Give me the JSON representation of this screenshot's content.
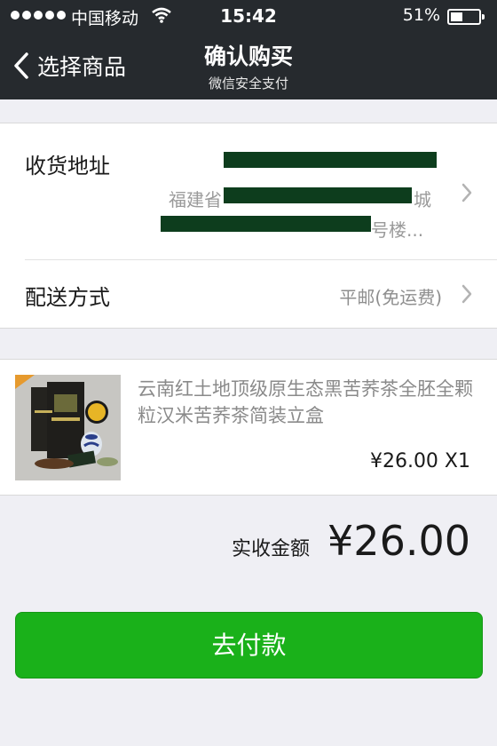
{
  "status_bar": {
    "carrier": "中国移动",
    "time": "15:42",
    "battery": "51%",
    "battery_level": 0.51
  },
  "nav": {
    "back_label": "选择商品",
    "title": "确认购买",
    "subtitle": "微信安全支付"
  },
  "address": {
    "label": "收货地址",
    "line1_visible": "福建省",
    "line1_end": "城",
    "line2_end": "号楼..."
  },
  "delivery": {
    "label": "配送方式",
    "value": "平邮(免运费)"
  },
  "product": {
    "title": "云南红土地顶级原生态黑苦荞茶全胚全颗粒汉米苦荞茶简装立盒",
    "price_qty": "¥26.00 X1"
  },
  "total": {
    "label": "实收金额",
    "amount": "¥26.00"
  },
  "pay_button": {
    "label": "去付款"
  },
  "colors": {
    "nav_bg": "#262a2e",
    "pay_green": "#1ab11a",
    "redaction": "#0d3d1d",
    "page_bg": "#efeff4"
  }
}
